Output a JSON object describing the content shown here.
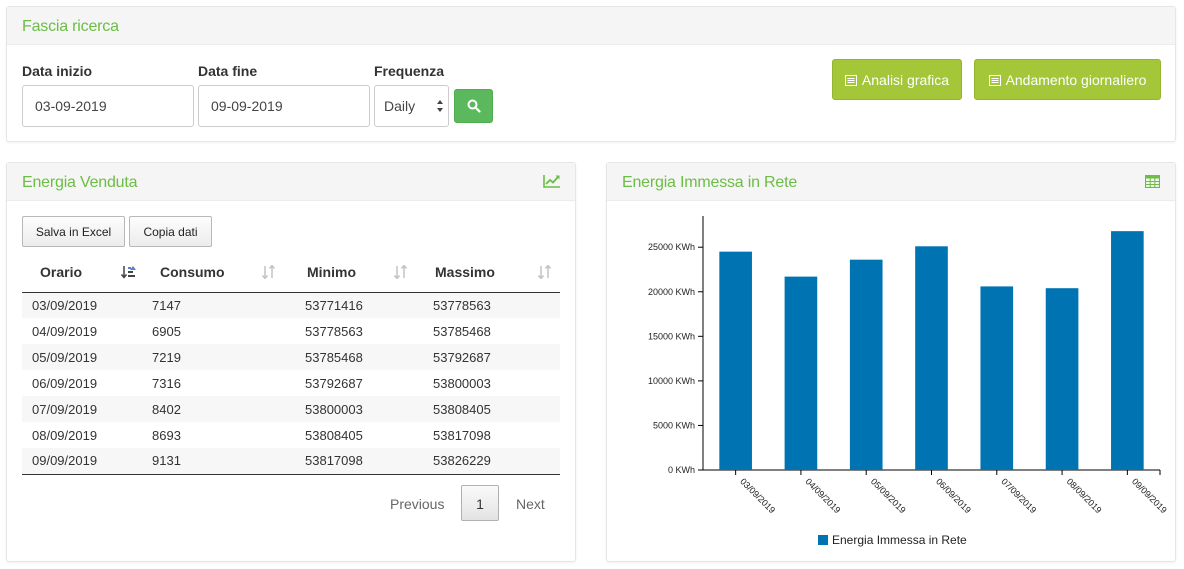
{
  "search": {
    "title": "Fascia ricerca",
    "start_label": "Data inizio",
    "start_value": "03-09-2019",
    "end_label": "Data fine",
    "end_value": "09-09-2019",
    "frequency_label": "Frequenza",
    "frequency_value": "Daily",
    "btn_analisi": "Analisi grafica",
    "btn_andamento": "Andamento giornaliero",
    "icons": {
      "search": "search-icon",
      "list": "list-icon"
    },
    "colors": {
      "title": "#6cbd45",
      "search_button": "#5cb85c",
      "action_button": "#a4c639"
    }
  },
  "venduta": {
    "title": "Energia Venduta",
    "header_icon": "line-chart-icon",
    "btn_excel": "Salva in Excel",
    "btn_copy": "Copia dati",
    "columns": [
      "Orario",
      "Consumo",
      "Minimo",
      "Massimo"
    ],
    "rows": [
      [
        "03/09/2019",
        "7147",
        "53771416",
        "53778563"
      ],
      [
        "04/09/2019",
        "6905",
        "53778563",
        "53785468"
      ],
      [
        "05/09/2019",
        "7219",
        "53785468",
        "53792687"
      ],
      [
        "06/09/2019",
        "7316",
        "53792687",
        "53800003"
      ],
      [
        "07/09/2019",
        "8402",
        "53800003",
        "53808405"
      ],
      [
        "08/09/2019",
        "8693",
        "53808405",
        "53817098"
      ],
      [
        "09/09/2019",
        "9131",
        "53817098",
        "53826229"
      ]
    ],
    "pager": {
      "prev": "Previous",
      "page": "1",
      "next": "Next"
    }
  },
  "immessa": {
    "title": "Energia Immessa in Rete",
    "header_icon": "table-icon"
  },
  "chart_data": {
    "type": "bar",
    "categories": [
      "03/09/2019",
      "04/09/2019",
      "05/09/2019",
      "06/09/2019",
      "07/09/2019",
      "08/09/2019",
      "09/09/2019"
    ],
    "series": [
      {
        "name": "Energia Immessa in Rete",
        "color": "#0074b3",
        "values": [
          24500,
          21700,
          23600,
          25100,
          20600,
          20400,
          26800
        ]
      }
    ],
    "yticks": [
      "0 KWh",
      "5000 KWh",
      "10000 KWh",
      "15000 KWh",
      "20000 KWh",
      "25000 KWh"
    ],
    "ylim": [
      0,
      28500
    ],
    "ystep": 5000,
    "legend": "bottom"
  }
}
